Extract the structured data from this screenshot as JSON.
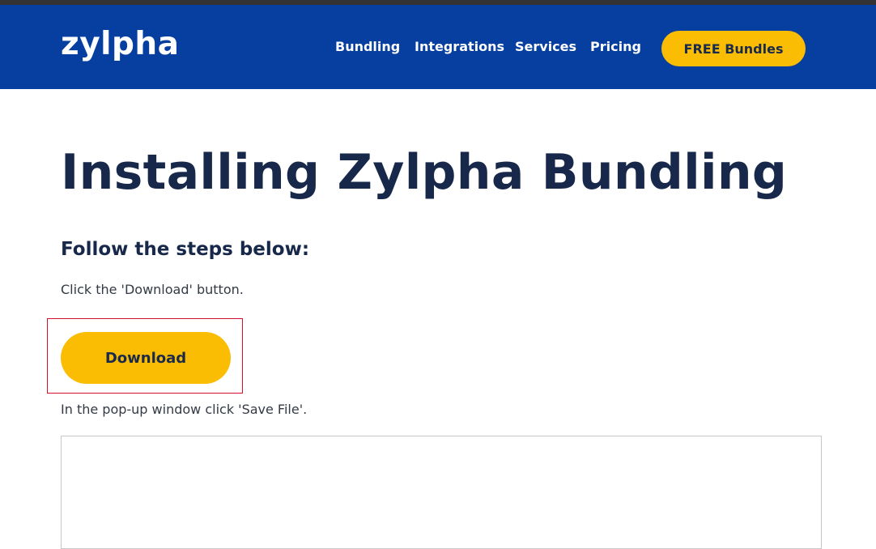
{
  "header": {
    "logo": "zylpha",
    "nav": [
      {
        "label": "Bundling"
      },
      {
        "label": "Integrations"
      },
      {
        "label": "Services"
      },
      {
        "label": "Pricing"
      }
    ],
    "cta_label": "FREE Bundles"
  },
  "main": {
    "title": "Installing Zylpha Bundling",
    "steps_heading": "Follow the steps below:",
    "step1_text": "Click the 'Download' button.",
    "download_label": "Download",
    "step2_text": "In the pop-up window click 'Save File'."
  },
  "colors": {
    "header_bg": "#063f9f",
    "accent_yellow": "#fbbc04",
    "title_text": "#17284a",
    "highlight_border": "#d6102a"
  }
}
